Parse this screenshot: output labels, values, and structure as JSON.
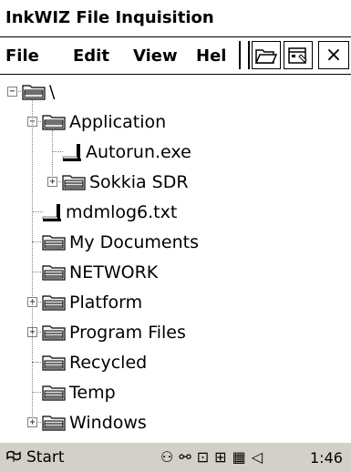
{
  "title": "InkWIZ File Inquisition",
  "menu": [
    "File",
    "Edit",
    "View",
    "Hel"
  ],
  "toolbar": {
    "close": "×"
  },
  "tree": [
    {
      "label": "\\",
      "type": "folder",
      "expanded": true
    },
    {
      "label": "Application",
      "type": "folder",
      "expanded": true
    },
    {
      "label": "Autorun.exe",
      "type": "file"
    },
    {
      "label": "Sokkia SDR",
      "type": "folder",
      "expanded": false
    },
    {
      "label": "mdmlog6.txt",
      "type": "file"
    },
    {
      "label": "My Documents",
      "type": "folder"
    },
    {
      "label": "NETWORK",
      "type": "folder"
    },
    {
      "label": "Platform",
      "type": "folder",
      "expanded": false
    },
    {
      "label": "Program Files",
      "type": "folder",
      "expanded": false
    },
    {
      "label": "Recycled",
      "type": "folder"
    },
    {
      "label": "Temp",
      "type": "folder"
    },
    {
      "label": "Windows",
      "type": "folder",
      "expanded": false
    }
  ],
  "taskbar": {
    "start_label": "Start",
    "clock": "1:46"
  }
}
